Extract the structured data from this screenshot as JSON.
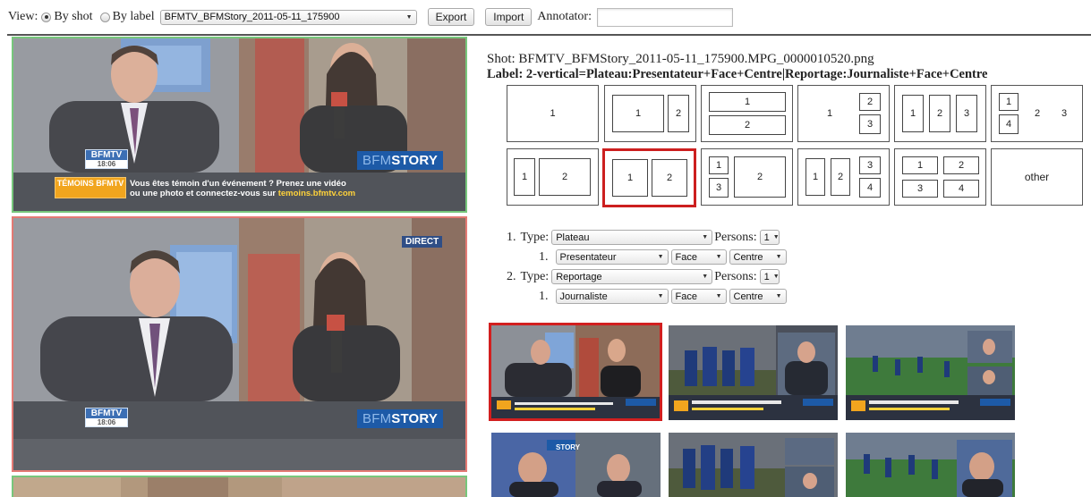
{
  "toolbar": {
    "view_label": "View:",
    "by_shot": "By shot",
    "by_label": "By label",
    "video_selected": "BFMTV_BFMStory_2011-05-11_175900",
    "export": "Export",
    "import": "Import",
    "annotator_label": "Annotator:",
    "annotator_value": ""
  },
  "strip": {
    "logo_name": "BFMTV",
    "logo_time": "18:06",
    "story_prefix": "BFM",
    "story_suffix": "STORY",
    "temoins_logo": "TÉMOINS BFMTV",
    "ticker_line1": "Vous êtes témoin d'un événement ? Prenez une vidéo",
    "ticker_line2a": "ou une photo et connectez-vous sur ",
    "ticker_line2b": "temoins.bfmtv.com",
    "direct": "DIRECT"
  },
  "info": {
    "shot": "Shot: BFMTV_BFMStory_2011-05-11_175900.MPG_0000010520.png",
    "label": "Label: 2-vertical=Plateau:Presentateur+Face+Centre|Reportage:Journaliste+Face+Centre"
  },
  "layouts": {
    "row1": {
      "l1": [
        "1"
      ],
      "l2": [
        "1",
        "2"
      ],
      "l3": [
        "1",
        "2"
      ],
      "l4": [
        "1",
        "2",
        "3"
      ],
      "l5": [
        "1",
        "2",
        "3"
      ],
      "l6": [
        "1",
        "4",
        "2",
        "3"
      ]
    },
    "row2": {
      "l1": [
        "1",
        "2"
      ],
      "l2": [
        "1",
        "2"
      ],
      "l3": [
        "1",
        "3",
        "2"
      ],
      "l4": [
        "1",
        "2",
        "3",
        "4"
      ],
      "l5": [
        "1",
        "2",
        "3",
        "4"
      ],
      "other": "other"
    }
  },
  "form": {
    "type_label": "Type:",
    "persons_label": "Persons:",
    "entries": [
      {
        "num": "1.",
        "type": "Plateau",
        "persons": "1",
        "sub_num": "1.",
        "role": "Presentateur",
        "orientation": "Face",
        "position": "Centre"
      },
      {
        "num": "2.",
        "type": "Reportage",
        "persons": "1",
        "sub_num": "1.",
        "role": "Journaliste",
        "orientation": "Face",
        "position": "Centre"
      }
    ]
  },
  "thumbs": {
    "story": "STORY",
    "ticker": "MONDIAL DE FOOT"
  },
  "colors": {
    "selected_red": "#cc1f1f",
    "green_frame": "#77c77c",
    "red_frame": "#e47a74",
    "bfm_blue": "#1d5aa7"
  }
}
